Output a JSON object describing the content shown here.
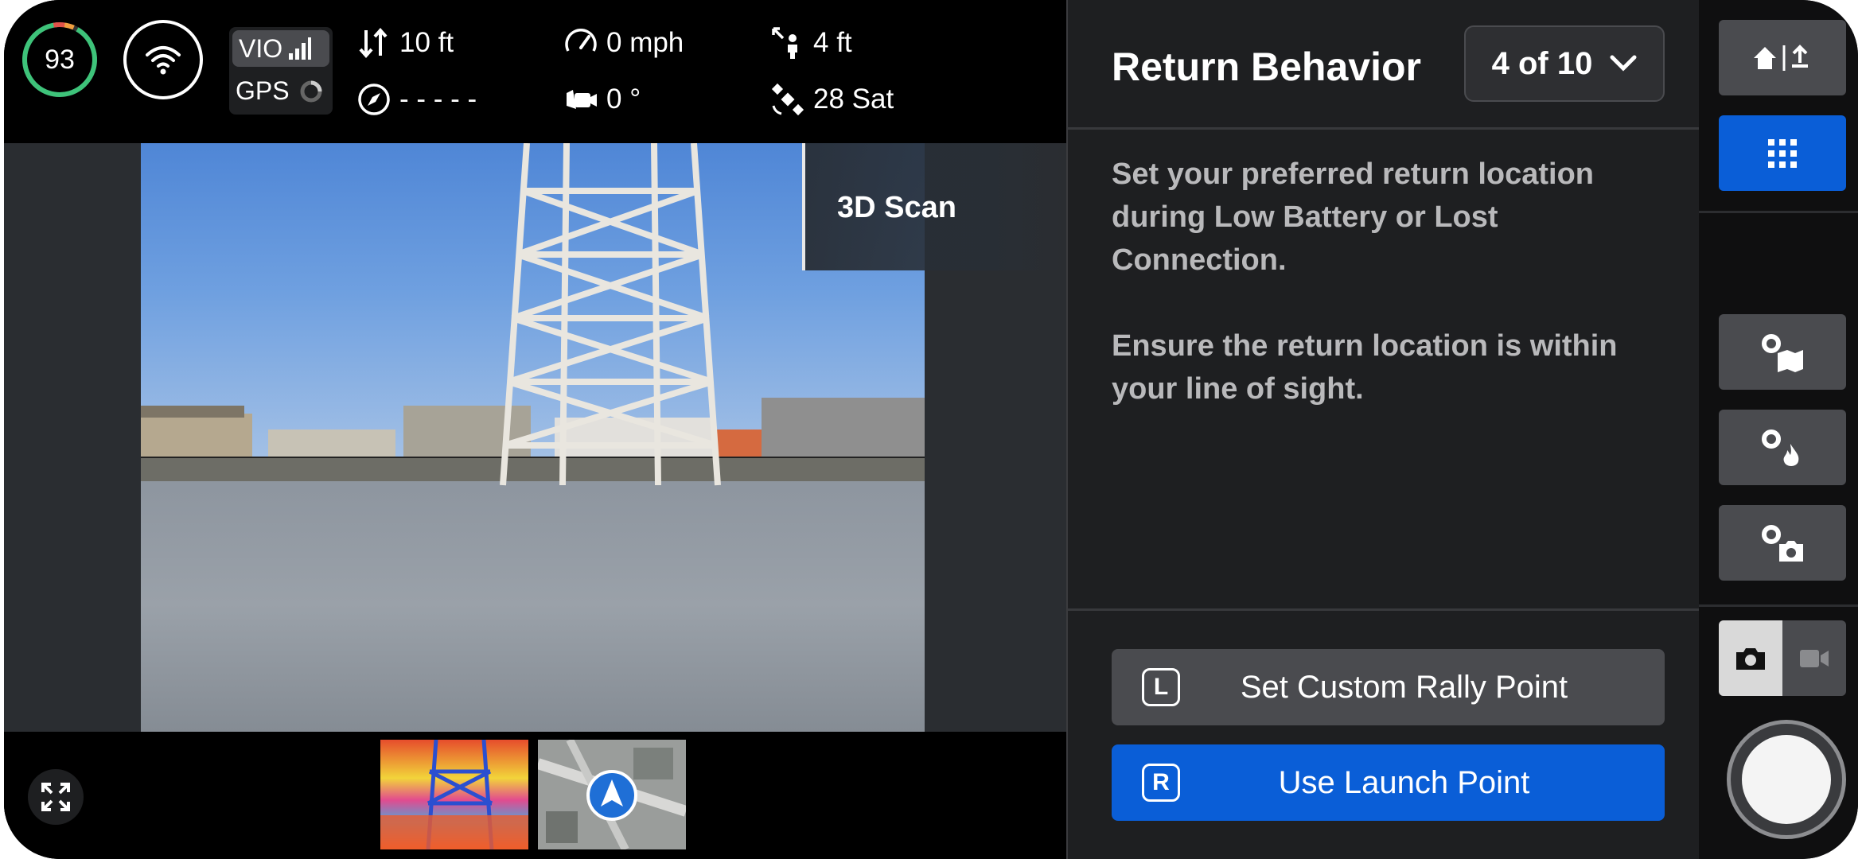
{
  "telemetry": {
    "battery_percent": "93",
    "vio_label": "VIO",
    "gps_label": "GPS",
    "altitude": "10 ft",
    "heading": "- - - - -",
    "speed": "0 mph",
    "gimbal_angle": "0 °",
    "distance": "4 ft",
    "satellites": "28 Sat"
  },
  "camera": {
    "overlay_label": "3D Scan",
    "thumbnails": [
      "thermal-view",
      "map-view"
    ]
  },
  "panel": {
    "title": "Return Behavior",
    "step": "4 of 10",
    "paragraph_1": "Set your preferred return location during Low Battery or Lost Connection.",
    "paragraph_2": "Ensure the return location is within your line of sight.",
    "buttons": {
      "rally": {
        "key": "L",
        "label": "Set Custom Rally Point"
      },
      "launch": {
        "key": "R",
        "label": "Use Launch Point"
      }
    }
  },
  "rail": {
    "icons": [
      "home-return-icon",
      "grid-menu-icon",
      "map-settings-icon",
      "thermal-settings-icon",
      "camera-settings-icon",
      "photo-mode-icon",
      "video-mode-icon",
      "shutter-button"
    ]
  },
  "colors": {
    "accent_blue": "#0a5ed7",
    "panel_bg": "#1e1f21",
    "battery_ring": "#3ec37a"
  }
}
